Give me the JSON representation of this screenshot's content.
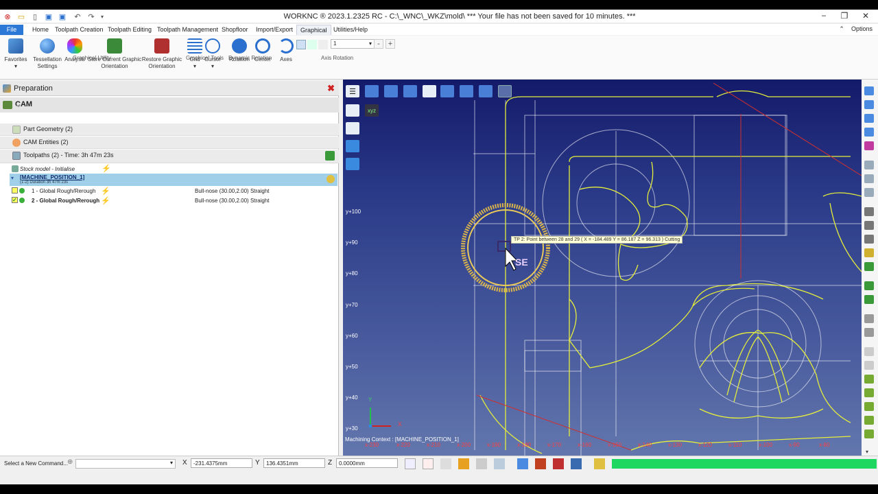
{
  "window": {
    "title": "WORKNC ® 2023.1.2325 RC - C:\\_WNC\\_WKZ\\mold\\ *** Your file has not been saved for 10 minutes. ***",
    "minimize": "−",
    "maximize": "❐",
    "close": "✕"
  },
  "menu": {
    "file": "File",
    "items": [
      "Home",
      "Toolpath Creation",
      "Toolpath Editing",
      "Toolpath Management",
      "Shopfloor",
      "Import/Export",
      "Graphical",
      "Utilities/Help"
    ],
    "options": "Options"
  },
  "ribbon": {
    "favorites": "Favorites",
    "tessellation": "Tessellation Settings",
    "analysis": "Analysis",
    "store": "Store Current Graphic Orientation",
    "restore": "Restore Graphic Orientation",
    "grid": "Grid",
    "cursor": "Cursor",
    "rotation": "Rotation",
    "center": "Center",
    "axes": "Axes",
    "groups": {
      "utility": "Graphical Utility",
      "tools": "Graphical Tools",
      "dynamic": "Dynamic Rotation",
      "axis": "Axis Rotation"
    },
    "axis_value": "1"
  },
  "panel": {
    "title": "Preparation",
    "cam": "CAM",
    "sections": {
      "part": "Part Geometry (2)",
      "entities": "CAM Entities (2)",
      "toolpaths": "Toolpaths (2) - Time: 3h 47m 23s"
    },
    "stock": "Stock model - Initialise",
    "machine": {
      "name": "[MACHINE_POSITION_1]",
      "duration": "(1-2) Duration 3h 47m 23s"
    },
    "toolpaths": [
      {
        "name": "1 - Global Rough/Rerough",
        "tool": "Bull-nose (30.00,2.00) Straight"
      },
      {
        "name": "2 - Global Rough/Rerough",
        "tool": "Bull-nose (30.00,2.00) Straight"
      }
    ]
  },
  "viewport": {
    "tooltip": "TP 2: Point between 28 and 29 ( X = -184.489  Y = 86.187  Z = 96.313 ) Cutting",
    "ylabels": [
      "y+100",
      "y+90",
      "y+80",
      "y+70",
      "y+60",
      "y+50",
      "y+40",
      "y+30"
    ],
    "xlabels": [
      "x-230",
      "x-220",
      "x-210",
      "x-200",
      "x-190",
      "x-180",
      "x-170",
      "x-160",
      "x-150",
      "x-140",
      "x-130",
      "x-120",
      "x-110",
      "x-100",
      "x-90",
      "x-80"
    ],
    "context": "Machining Context : [MACHINE_POSITION_1]",
    "axis_x": "X",
    "axis_y": "Y",
    "cursor_label": "SE"
  },
  "status": {
    "prompt": "Select a New Command...",
    "x_label": "X",
    "x_value": "-231.4375mm",
    "y_label": "Y",
    "y_value": "136.4351mm",
    "z_label": "Z",
    "z_value": "0.0000mm"
  }
}
